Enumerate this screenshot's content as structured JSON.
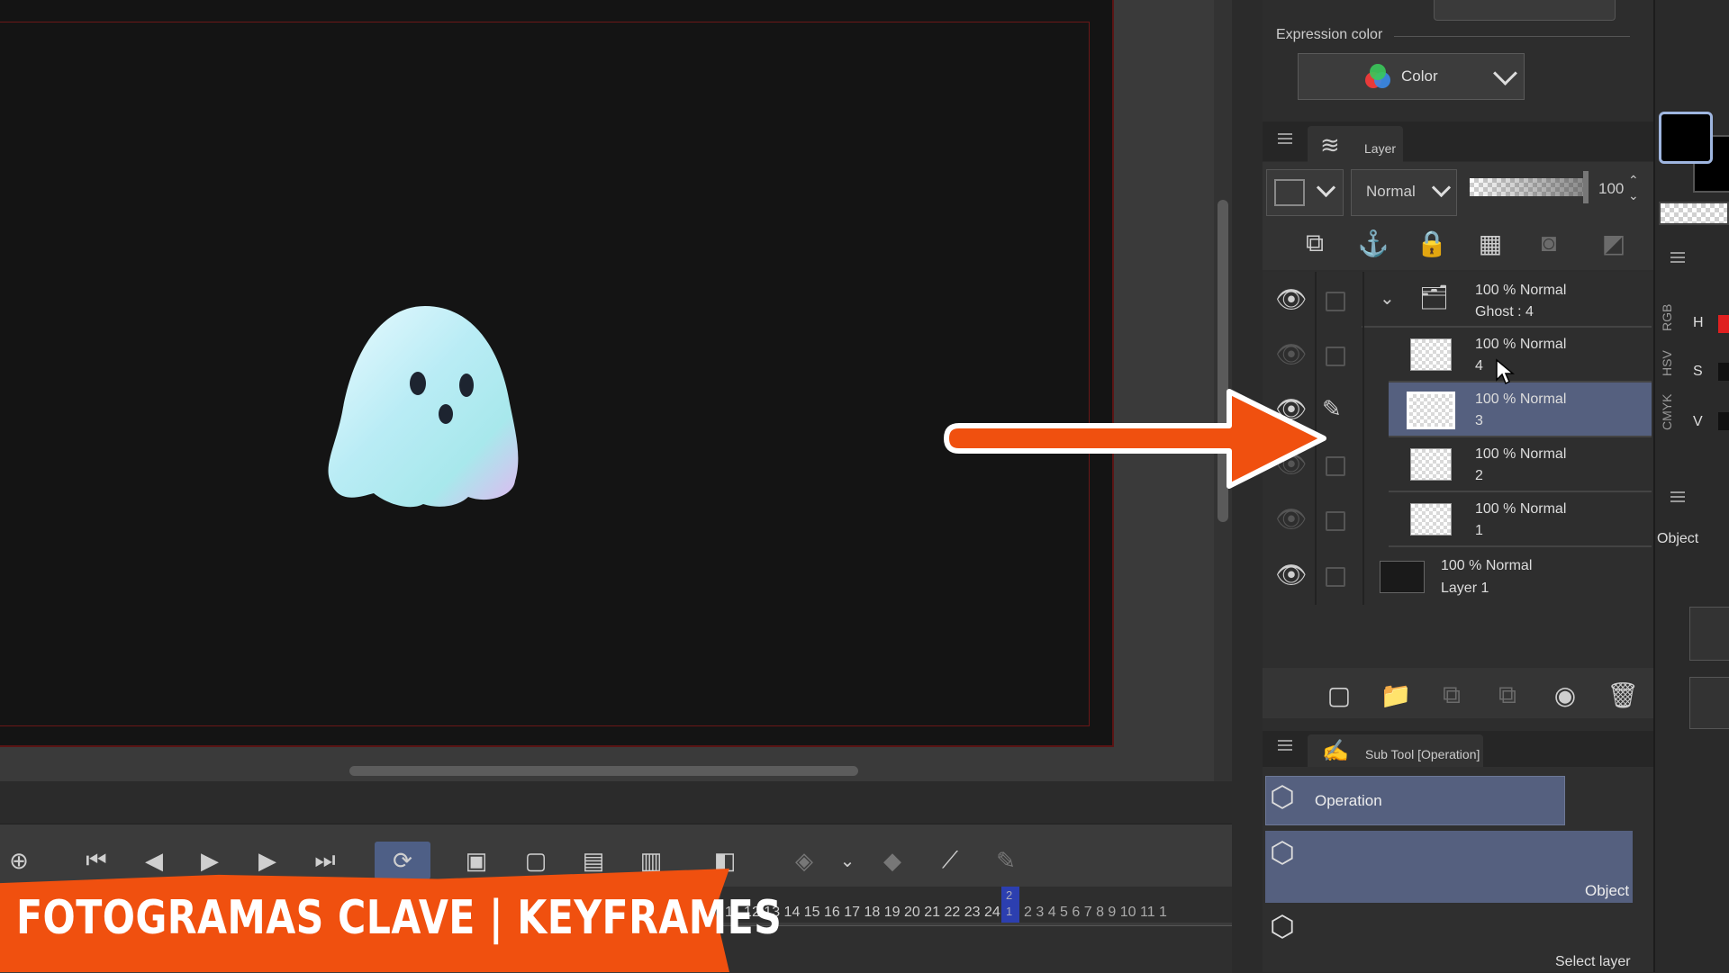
{
  "banner": {
    "text": "FOTOGRAMAS CLAVE | KEYFRAMES",
    "color": "#f0500f"
  },
  "expression_color": {
    "label": "Expression color",
    "value": "Color"
  },
  "layer_panel": {
    "tab_label": "Layer",
    "blend_mode": "Normal",
    "opacity_value": "100",
    "layers": [
      {
        "line1": "100 % Normal",
        "line2": "Ghost : 4",
        "type": "animation-folder",
        "visible": true,
        "selected": false
      },
      {
        "line1": "100 % Normal",
        "line2": "4",
        "type": "raster",
        "visible": false,
        "selected": false
      },
      {
        "line1": "100 % Normal",
        "line2": "3",
        "type": "raster",
        "visible": true,
        "selected": true
      },
      {
        "line1": "100 % Normal",
        "line2": "2",
        "type": "raster",
        "visible": false,
        "selected": false
      },
      {
        "line1": "100 % Normal",
        "line2": "1",
        "type": "raster",
        "visible": false,
        "selected": false
      },
      {
        "line1": "100 % Normal",
        "line2": "Layer 1",
        "type": "paper",
        "visible": true,
        "selected": false
      }
    ]
  },
  "sub_tool": {
    "tab_label": "Sub Tool [Operation]",
    "items": [
      {
        "label": "Operation"
      },
      {
        "label": "Object"
      },
      {
        "label": "Select layer"
      }
    ]
  },
  "color_panel": {
    "tabs": [
      "RGB",
      "HSV",
      "CMYK"
    ],
    "h_label": "H",
    "s_label": "S",
    "v_label": "V",
    "main_color": "#000000",
    "h_color": "#e02020"
  },
  "object_panel_label": "Object",
  "timeline": {
    "frame_numbers": "11 12 13 14 15 16 17 18 19 20 21 22 23 24",
    "after_marker": "2 3 4 5 6 7 8 9 10 11 1",
    "marker_top": "2",
    "marker_bottom": "1"
  },
  "colors": {
    "accent": "#55607f",
    "arrow": "#f0500f",
    "canvas_bg": "#141414",
    "frame_border": "#5a1414"
  }
}
